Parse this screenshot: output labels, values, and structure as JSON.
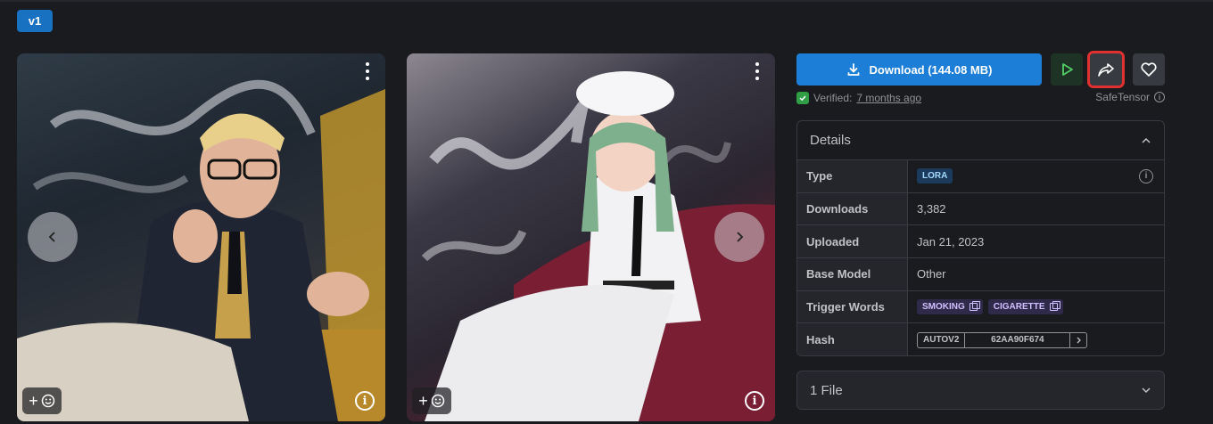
{
  "version": {
    "label": "v1"
  },
  "gallery": {
    "images": [
      {
        "alt": "man-smoking-illustration"
      },
      {
        "alt": "girl-smoking-illustration"
      }
    ],
    "react_label": "+",
    "info_label": "i"
  },
  "actions": {
    "download_label": "Download (144.08 MB)",
    "accent": "#1c7ed6",
    "highlight_color": "#e03131"
  },
  "verification": {
    "prefix": "Verified:",
    "time": "7 months ago",
    "format": "SafeTensor"
  },
  "details": {
    "title": "Details",
    "rows": [
      {
        "key": "Type",
        "value": "LORA"
      },
      {
        "key": "Downloads",
        "value": "3,382"
      },
      {
        "key": "Uploaded",
        "value": "Jan 21, 2023"
      },
      {
        "key": "Base Model",
        "value": "Other"
      },
      {
        "key": "Trigger Words",
        "values": [
          "SMOKING",
          "CIGARETTE"
        ]
      },
      {
        "key": "Hash",
        "hash_type": "AUTOV2",
        "hash_value": "62AA90F674"
      }
    ]
  },
  "files": {
    "title": "1 File"
  }
}
